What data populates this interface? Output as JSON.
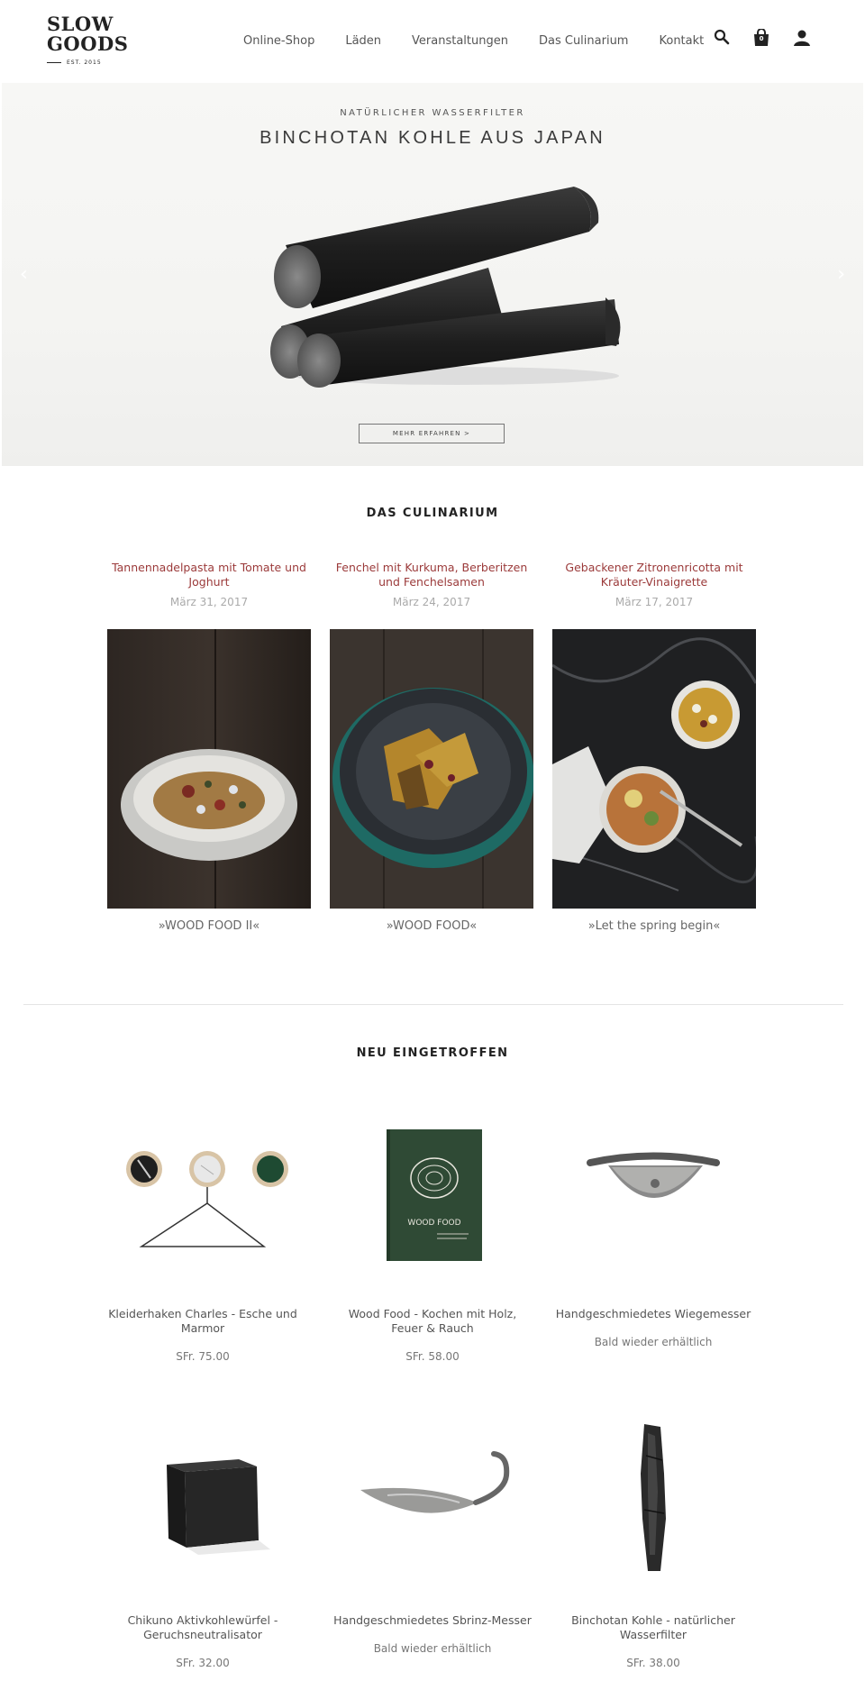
{
  "brand": {
    "line1": "SLOW",
    "line2": "GOODS",
    "est": "EST. 2015"
  },
  "nav": [
    "Online-Shop",
    "Läden",
    "Veranstaltungen",
    "Das Culinarium",
    "Kontakt"
  ],
  "header_icons": {
    "search": "search-icon",
    "cart": "shopping-bag-icon",
    "cart_count": "0",
    "account": "user-icon"
  },
  "hero": {
    "subtitle": "NATÜRLICHER WASSERFILTER",
    "title": "BINCHOTAN KOHLE AUS JAPAN",
    "button": "MEHR ERFAHREN  >",
    "prev": "‹",
    "next": "›"
  },
  "culinarium": {
    "heading": "DAS CULINARIUM",
    "posts": [
      {
        "title": "Tannennadelpasta mit Tomate und Joghurt",
        "date": "März 31, 2017",
        "caption": "»WOOD FOOD II«"
      },
      {
        "title": "Fenchel mit Kurkuma, Berberitzen und Fenchelsamen",
        "date": "März 24, 2017",
        "caption": "»WOOD FOOD«"
      },
      {
        "title": "Gebackener Zitronenricotta mit Kräuter-Vinaigrette",
        "date": "März 17, 2017",
        "caption": "»Let the spring begin«"
      }
    ]
  },
  "new_arrivals": {
    "heading": "NEU EINGETROFFEN",
    "products": [
      {
        "name": "Kleiderhaken Charles - Esche und Marmor",
        "price": "SFr. 75.00"
      },
      {
        "name": "Wood Food - Kochen mit Holz, Feuer & Rauch",
        "price": "SFr. 58.00",
        "book_title": "WOOD FOOD"
      },
      {
        "name": "Handgeschmiedetes Wiegemesser",
        "price": "Bald wieder erhältlich"
      },
      {
        "name": "Chikuno Aktivkohlewürfel - Geruchsneutralisator",
        "price": "SFr. 32.00"
      },
      {
        "name": "Handgeschmiedetes Sbrinz-Messer",
        "price": "Bald wieder erhältlich"
      },
      {
        "name": "Binchotan Kohle - natürlicher Wasserfilter",
        "price": "SFr. 38.00"
      }
    ]
  },
  "colors": {
    "accent": "#9b3a3a",
    "text": "#333333",
    "muted": "#aaaaaa"
  }
}
